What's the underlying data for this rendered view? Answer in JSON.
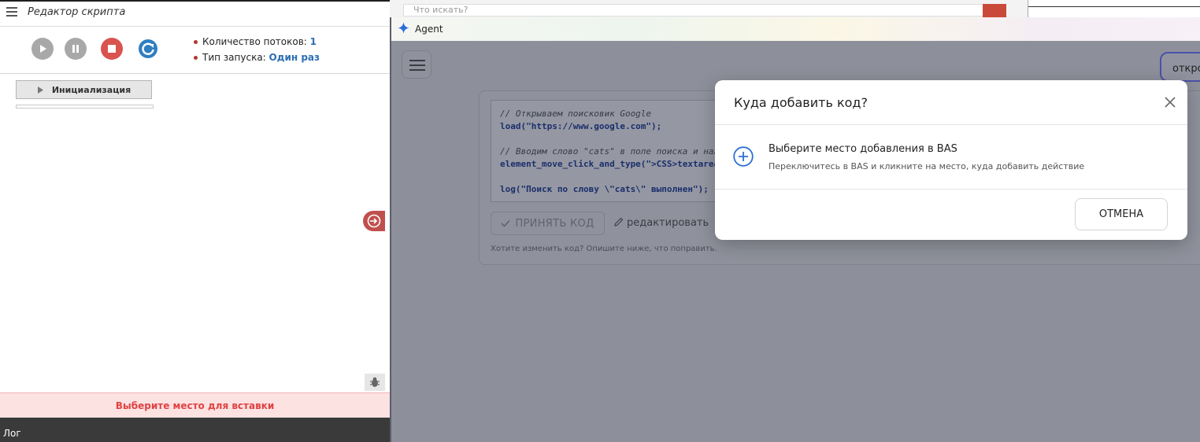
{
  "editor": {
    "title": "Редактор скрипта",
    "threads_label": "Количество потоков:",
    "threads_value": "1",
    "launch_label": "Тип запуска:",
    "launch_value": "Один раз",
    "init_block_label": "Инициализация",
    "insert_banner": "Выберите место для вставки",
    "log_label": "Лог"
  },
  "background_window": {
    "search_placeholder": "Что искать?"
  },
  "agent": {
    "title": "Agent",
    "open_label": "откро",
    "code_lines": [
      "// Открываем поисковик Google",
      "load(\"https://www.google.com\");",
      "",
      "// Вводим слово \"cats\" в поле поиска и наж",
      "element_move_click_and_type(\">CSS>textarea",
      "",
      "log(\"Поиск по слову \\\"cats\\\" выполнен\");"
    ],
    "accept_label": "ПРИНЯТЬ КОД",
    "edit_label": "редактировать",
    "change_hint": "Хотите изменить код? Опишите ниже, что поправить."
  },
  "modal": {
    "title": "Куда добавить код?",
    "option_title": "Выберите место добавления в BAS",
    "option_subtitle": "Переключитесь в BAS и кликните на место, куда добавить действие",
    "cancel_label": "ОТМЕНА"
  },
  "colors": {
    "stop_red": "#d9534f",
    "accent_blue": "#2d6fb5",
    "banner_text": "#e04343",
    "modal_plus": "#2f6fd6"
  },
  "icons": [
    "menu-icon",
    "play-icon",
    "pause-icon",
    "stop-icon",
    "restart-icon",
    "collapse-icon",
    "bug-icon",
    "sparkle-icon",
    "close-icon",
    "plus-circle-icon",
    "check-icon",
    "pencil-icon",
    "search-icon"
  ]
}
